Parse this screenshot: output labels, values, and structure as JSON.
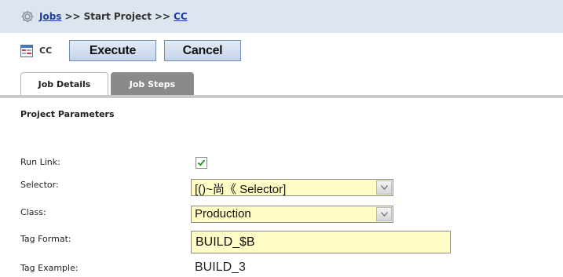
{
  "breadcrumb": {
    "jobs_link": "Jobs",
    "separator1": ">>",
    "start_project": "Start Project",
    "separator2": ">>",
    "project_link": "CC"
  },
  "toolbar": {
    "project_name": "CC",
    "execute_label": "Execute",
    "cancel_label": "Cancel"
  },
  "tabs": [
    {
      "label": "Job Details",
      "active": true
    },
    {
      "label": "Job Steps",
      "active": false
    }
  ],
  "section": {
    "title": "Project Parameters"
  },
  "form": {
    "run_link": {
      "label": "Run Link:",
      "checked": true
    },
    "selector": {
      "label": "Selector:",
      "value": "[()~尚《 Selector]"
    },
    "class": {
      "label": "Class:",
      "value": "Production"
    },
    "tag_format": {
      "label": "Tag Format:",
      "value": "BUILD_$B"
    },
    "tag_example": {
      "label": "Tag Example:",
      "value": "BUILD_3"
    }
  },
  "colors": {
    "header_bg": "#dde5ef",
    "link": "#1a3fa0",
    "field_bg": "#fffdc5",
    "inactive_tab": "#8a8a8a",
    "check": "#2e9c2e"
  },
  "icons": [
    "gear-icon",
    "project-icon",
    "checkmark-icon",
    "dropdown-arrow-icon"
  ]
}
